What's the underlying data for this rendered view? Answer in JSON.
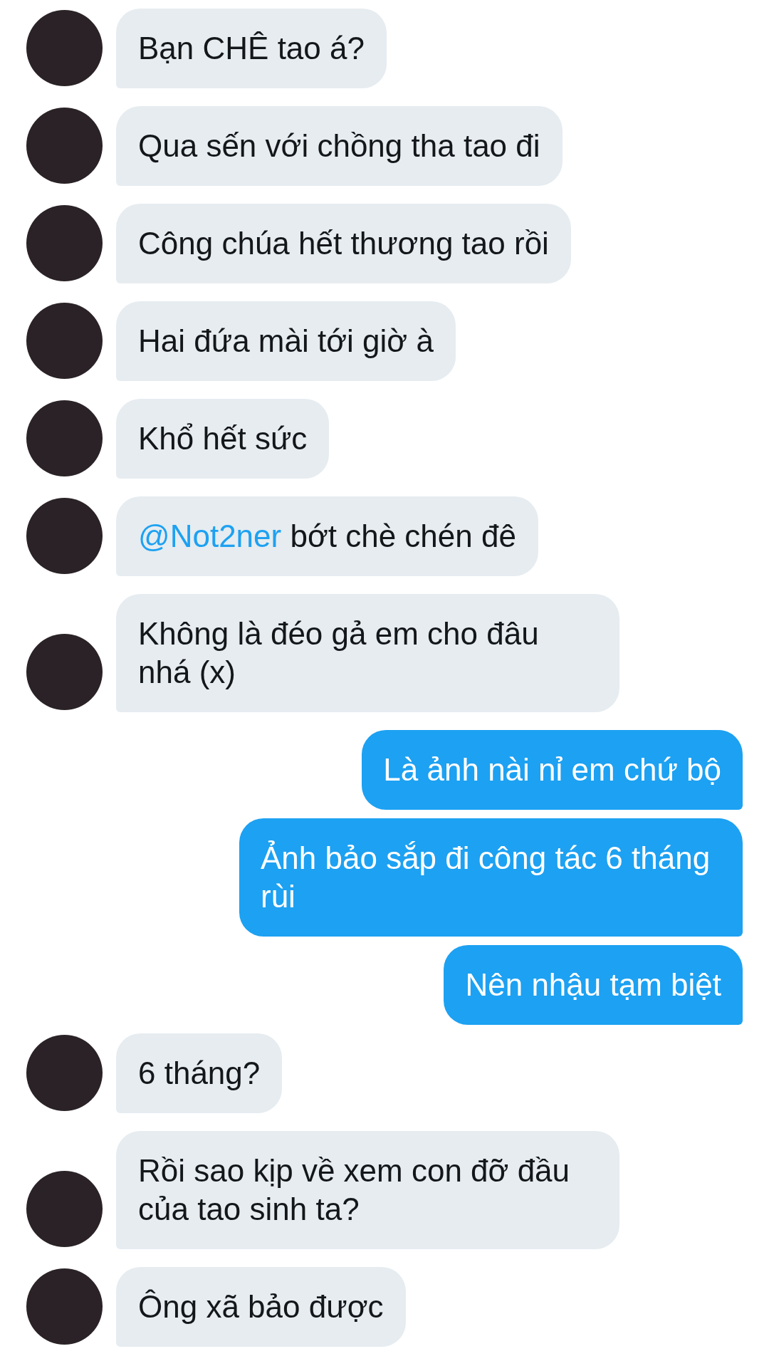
{
  "messages": [
    {
      "kind": "received",
      "parts": [
        {
          "kind": "text",
          "text": "Bạn CHÊ tao á?"
        }
      ]
    },
    {
      "kind": "received",
      "parts": [
        {
          "kind": "text",
          "text": "Qua sến với chồng tha tao đi"
        }
      ]
    },
    {
      "kind": "received",
      "parts": [
        {
          "kind": "text",
          "text": "Công chúa hết thương tao rồi"
        }
      ]
    },
    {
      "kind": "received",
      "parts": [
        {
          "kind": "text",
          "text": "Hai đứa mài tới giờ à"
        }
      ]
    },
    {
      "kind": "received",
      "parts": [
        {
          "kind": "text",
          "text": "Khổ hết sức"
        }
      ]
    },
    {
      "kind": "received",
      "parts": [
        {
          "kind": "mention",
          "text": "@Not2ner"
        },
        {
          "kind": "text",
          "text": " bớt chè chén đê"
        }
      ]
    },
    {
      "kind": "received",
      "parts": [
        {
          "kind": "text",
          "text": "Không là đéo gả em cho đâu nhá (x)"
        }
      ]
    },
    {
      "kind": "sent",
      "parts": [
        {
          "kind": "text",
          "text": "Là ảnh nài nỉ em chứ bộ"
        }
      ]
    },
    {
      "kind": "sent",
      "parts": [
        {
          "kind": "text",
          "text": "Ảnh bảo sắp đi công tác 6 tháng rùi"
        }
      ]
    },
    {
      "kind": "sent",
      "parts": [
        {
          "kind": "text",
          "text": "Nên nhậu tạm biệt"
        }
      ]
    },
    {
      "kind": "received",
      "parts": [
        {
          "kind": "text",
          "text": "6 tháng?"
        }
      ]
    },
    {
      "kind": "received",
      "parts": [
        {
          "kind": "text",
          "text": "Rồi sao kịp về xem con đỡ đầu của tao sinh ta?"
        }
      ]
    },
    {
      "kind": "received",
      "parts": [
        {
          "kind": "text",
          "text": "Ông xã bảo được"
        }
      ]
    }
  ]
}
